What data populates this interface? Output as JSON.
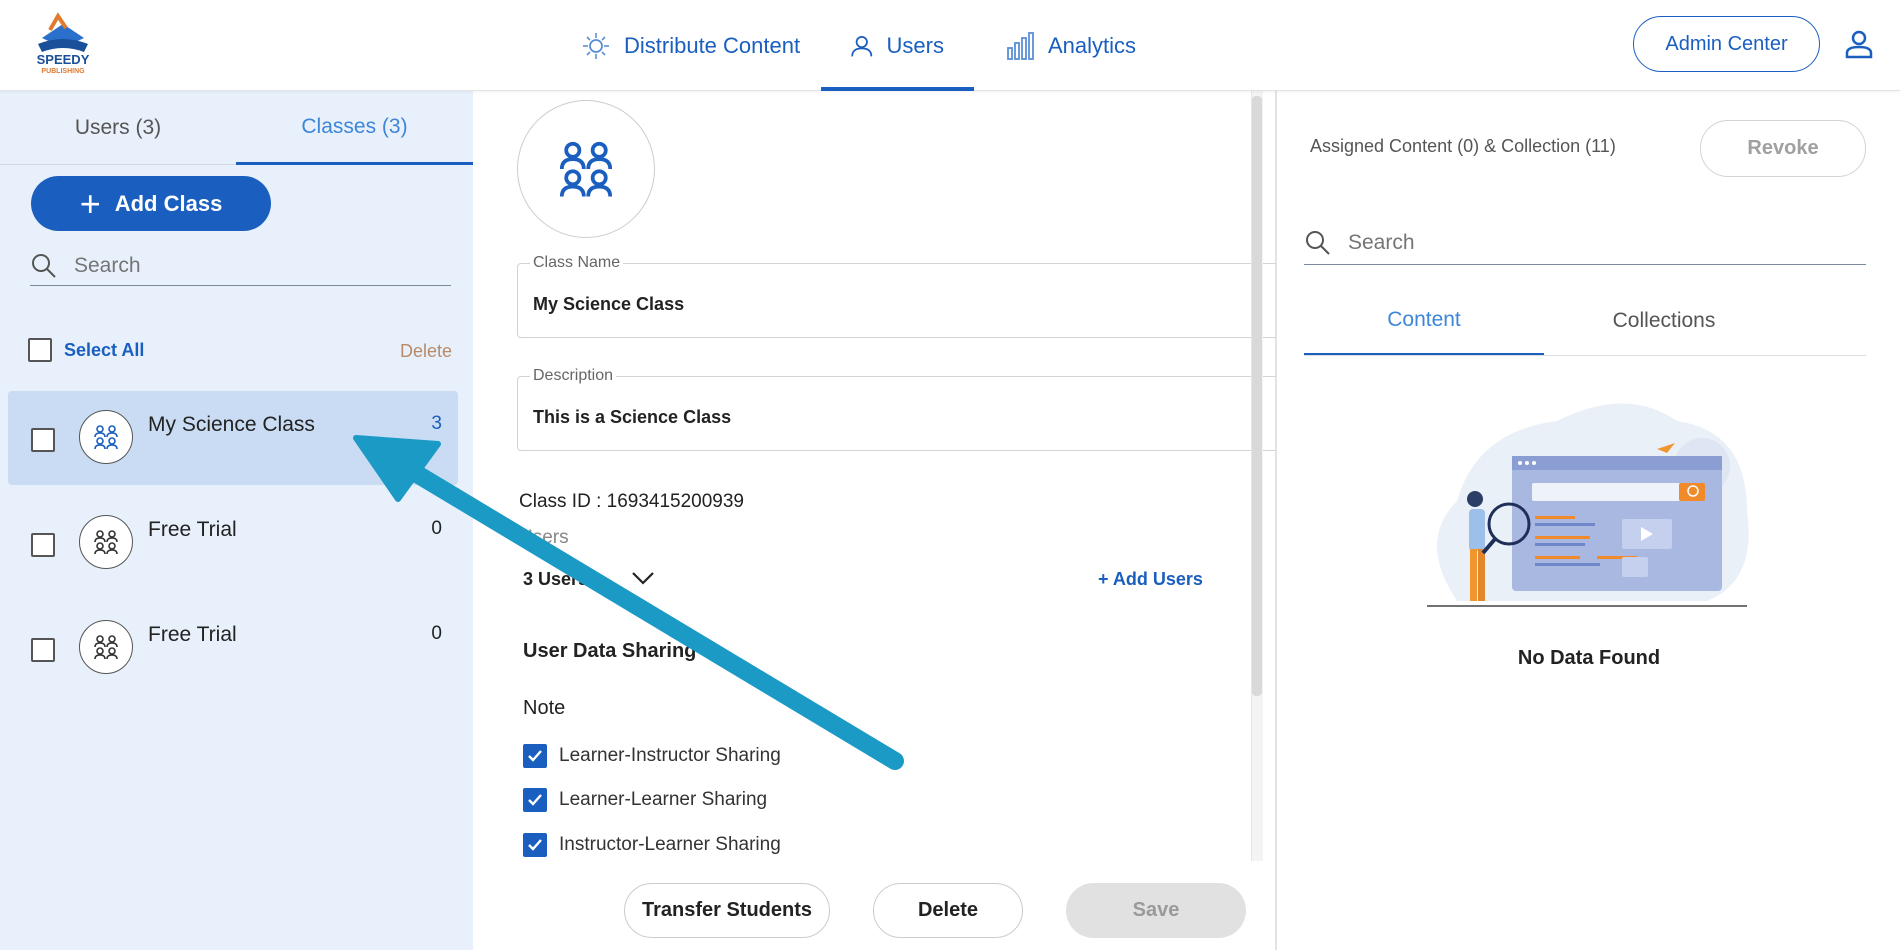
{
  "topnav": {
    "logo_alt": "SPEEDY PUBLISHING",
    "tabs": [
      {
        "label": "Distribute Content",
        "icon": "distribute-icon",
        "active": false
      },
      {
        "label": "Users",
        "icon": "user-icon",
        "active": true
      },
      {
        "label": "Analytics",
        "icon": "bar-chart-icon",
        "active": false
      }
    ],
    "admin_center_label": "Admin Center"
  },
  "left_panel": {
    "tabs": [
      {
        "label": "Users (3)",
        "active": false
      },
      {
        "label": "Classes (3)",
        "active": true
      }
    ],
    "add_class_label": "Add Class",
    "search_placeholder": "Search",
    "select_all_label": "Select All",
    "delete_label": "Delete",
    "classes": [
      {
        "name": "My Science Class",
        "count": "3",
        "selected": true
      },
      {
        "name": "Free Trial",
        "count": "0",
        "selected": false
      },
      {
        "name": "Free Trial",
        "count": "0",
        "selected": false
      }
    ]
  },
  "detail": {
    "class_name_label": "Class Name",
    "class_name_value": "My Science Class",
    "description_label": "Description",
    "description_value": "This is a Science Class",
    "class_id_text": "Class ID : 1693415200939",
    "users_label": "Users",
    "users_dropdown_value": "3 Users",
    "add_users_label": "+ Add Users",
    "user_data_sharing_heading": "User Data Sharing",
    "note_label": "Note",
    "sharing_options": [
      {
        "label": "Learner-Instructor Sharing",
        "checked": true
      },
      {
        "label": "Learner-Learner Sharing",
        "checked": true
      },
      {
        "label": "Instructor-Learner Sharing",
        "checked": true
      }
    ],
    "buttons": {
      "transfer_label": "Transfer Students",
      "delete_label": "Delete",
      "save_label": "Save"
    }
  },
  "right_panel": {
    "assigned_label": "Assigned Content (0) & Collection (11)",
    "revoke_label": "Revoke",
    "search_placeholder": "Search",
    "tabs": [
      {
        "label": "Content",
        "active": true
      },
      {
        "label": "Collections",
        "active": false
      }
    ],
    "empty_text": "No Data Found"
  },
  "colors": {
    "primary": "#1a5fc0",
    "tab_active_text": "#3d86d8",
    "left_bg": "#e8f1fb",
    "selected_row": "#c9dcf3",
    "annotation_arrow": "#1b9ac6",
    "delete_link": "#b98a6a"
  }
}
